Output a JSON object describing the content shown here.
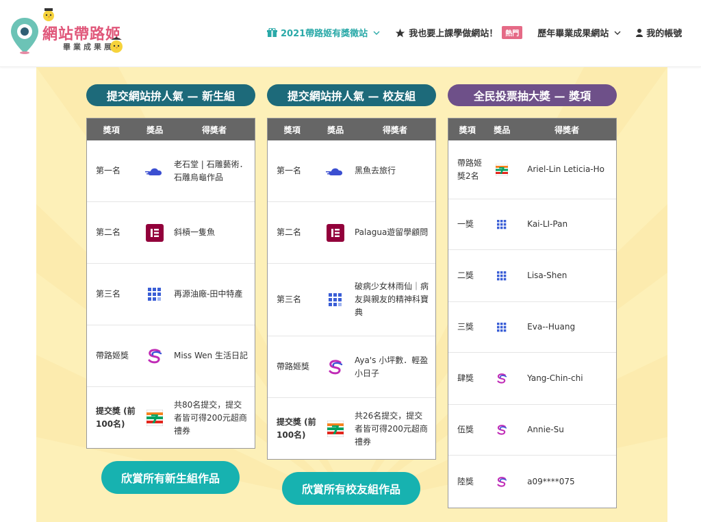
{
  "header": {
    "logo_title": "網站帶路姬",
    "logo_sub": "畢業成果展",
    "nav": [
      {
        "label": "2021帶路姬有獎徵站",
        "active": true
      },
      {
        "label": "我也要上課學做網站！",
        "badge": "熱門"
      },
      {
        "label": "歷年畢業成果網站"
      },
      {
        "label": "我的帳號"
      }
    ]
  },
  "columns": [
    {
      "title": "提交網站拚人氣 — 新生組",
      "headers": [
        "獎項",
        "獎品",
        "得獎者"
      ],
      "rows": [
        {
          "award": "第一名",
          "prize_icon": "cloud-icon",
          "winner": "老石堂 | 石雕藝術．石雕烏龜作品"
        },
        {
          "award": "第二名",
          "prize_icon": "elementor-icon",
          "winner": "斜槓一隻魚"
        },
        {
          "award": "第三名",
          "prize_icon": "grid-icon",
          "winner": "再源油廠-田中特產"
        },
        {
          "award": "帶路姬獎",
          "prize_icon": "s-logo-icon",
          "winner": "Miss Wen 生活日記"
        },
        {
          "award": "提交獎 (前100名)",
          "prize_icon": "seven-eleven-icon",
          "winner": "共80名提交，提交者皆可得200元超商禮券"
        }
      ],
      "button": "欣賞所有新生組作品"
    },
    {
      "title": "提交網站拚人氣 — 校友組",
      "headers": [
        "獎項",
        "獎品",
        "得獎者"
      ],
      "rows": [
        {
          "award": "第一名",
          "prize_icon": "cloud-icon",
          "winner": "黑魚去旅行"
        },
        {
          "award": "第二名",
          "prize_icon": "elementor-icon",
          "winner": "Palagua遊留學顧問"
        },
        {
          "award": "第三名",
          "prize_icon": "grid-icon",
          "winner": "破病少女林雨仙｜病友與親友的精神科寶典"
        },
        {
          "award": "帶路姬獎",
          "prize_icon": "s-logo-icon",
          "winner": "Aya's 小坪數．輕盈小日子"
        },
        {
          "award": "提交獎 (前100名)",
          "prize_icon": "seven-eleven-icon",
          "winner": "共26名提交，提交者皆可得200元超商禮券"
        }
      ],
      "button": "欣賞所有校友組作品"
    },
    {
      "title": "全民投票抽大獎 — 獎項",
      "headers": [
        "獎項",
        "獎品",
        "得獎者"
      ],
      "rows": [
        {
          "award": "帶路姬獎2名",
          "prize_icon": "seven-eleven-icon",
          "winner": "Ariel-Lin Leticia-Ho"
        },
        {
          "award": "一獎",
          "prize_icon": "grid-icon",
          "winner": "Kai-LI-Pan"
        },
        {
          "award": "二獎",
          "prize_icon": "grid-icon",
          "winner": "Lisa-Shen"
        },
        {
          "award": "三獎",
          "prize_icon": "grid-icon",
          "winner": "Eva--Huang"
        },
        {
          "award": "肆獎",
          "prize_icon": "s-logo-icon",
          "winner": "Yang-Chin-chi"
        },
        {
          "award": "伍獎",
          "prize_icon": "s-logo-icon",
          "winner": "Annie-Su"
        },
        {
          "award": "陸獎",
          "prize_icon": "s-logo-icon",
          "winner": "a09****075"
        }
      ]
    }
  ],
  "colors": {
    "teal": "#1d6a7a",
    "purple": "#6e5089",
    "button": "#17b2b0",
    "brand_pink": "#e0577a",
    "accent": "#2aa9a8"
  }
}
